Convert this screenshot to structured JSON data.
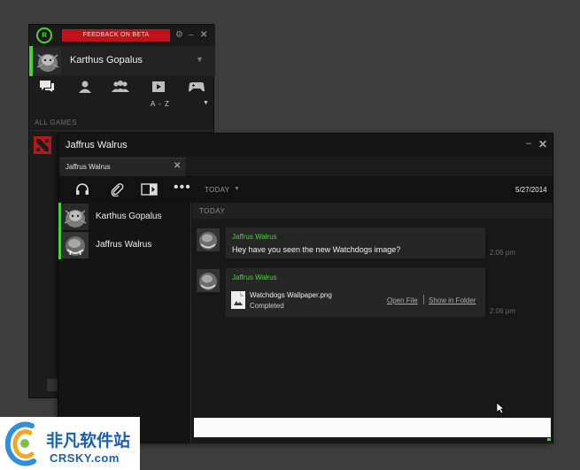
{
  "back_window": {
    "feedback_label": "FEEDBACK ON BETA",
    "settings_icon": "gear-icon",
    "minimize_label": "–",
    "close_label": "✕",
    "profile_name": "Karthus Gopalus",
    "profile_caret": "▼",
    "nav_tabs": [
      "chat-icon",
      "user-icon",
      "group-icon",
      "video-icon",
      "gamepad-icon"
    ],
    "sort_label": "A - Z",
    "sort_caret": "▼",
    "all_games_label": "ALL GAMES"
  },
  "chat_window": {
    "title": "Jaffrus Walrus",
    "minimize_label": "–",
    "close_label": "✕",
    "tab_label": "Jaffrus Walrus",
    "tab_close": "✕",
    "toolbar": {
      "more_label": "•••",
      "date_filter": "TODAY",
      "date_caret": "▼",
      "current_date": "5/27/2014"
    },
    "participants": [
      {
        "name": "Karthus Gopalus"
      },
      {
        "name": "Jaffrus Walrus"
      }
    ],
    "day_header": "TODAY",
    "messages": [
      {
        "sender": "Jaffrus Walrus",
        "text": "Hey have you seen the new Watchdogs image?",
        "time": "2:06 pm"
      },
      {
        "sender": "Jaffrus Walrus",
        "file_name": "Watchdogs Wallpaper.png",
        "file_status": "Completed",
        "open_label": "Open File",
        "folder_label": "Show in Folder",
        "time": "2:06 pm"
      }
    ],
    "input_value": ""
  },
  "watermark": {
    "cn_text": "非凡软件站",
    "en_text": "CRSKY.com"
  },
  "colors": {
    "accent": "#44d62c",
    "feedback": "#c0121a",
    "watermark_blue": "#1a5fb4"
  }
}
